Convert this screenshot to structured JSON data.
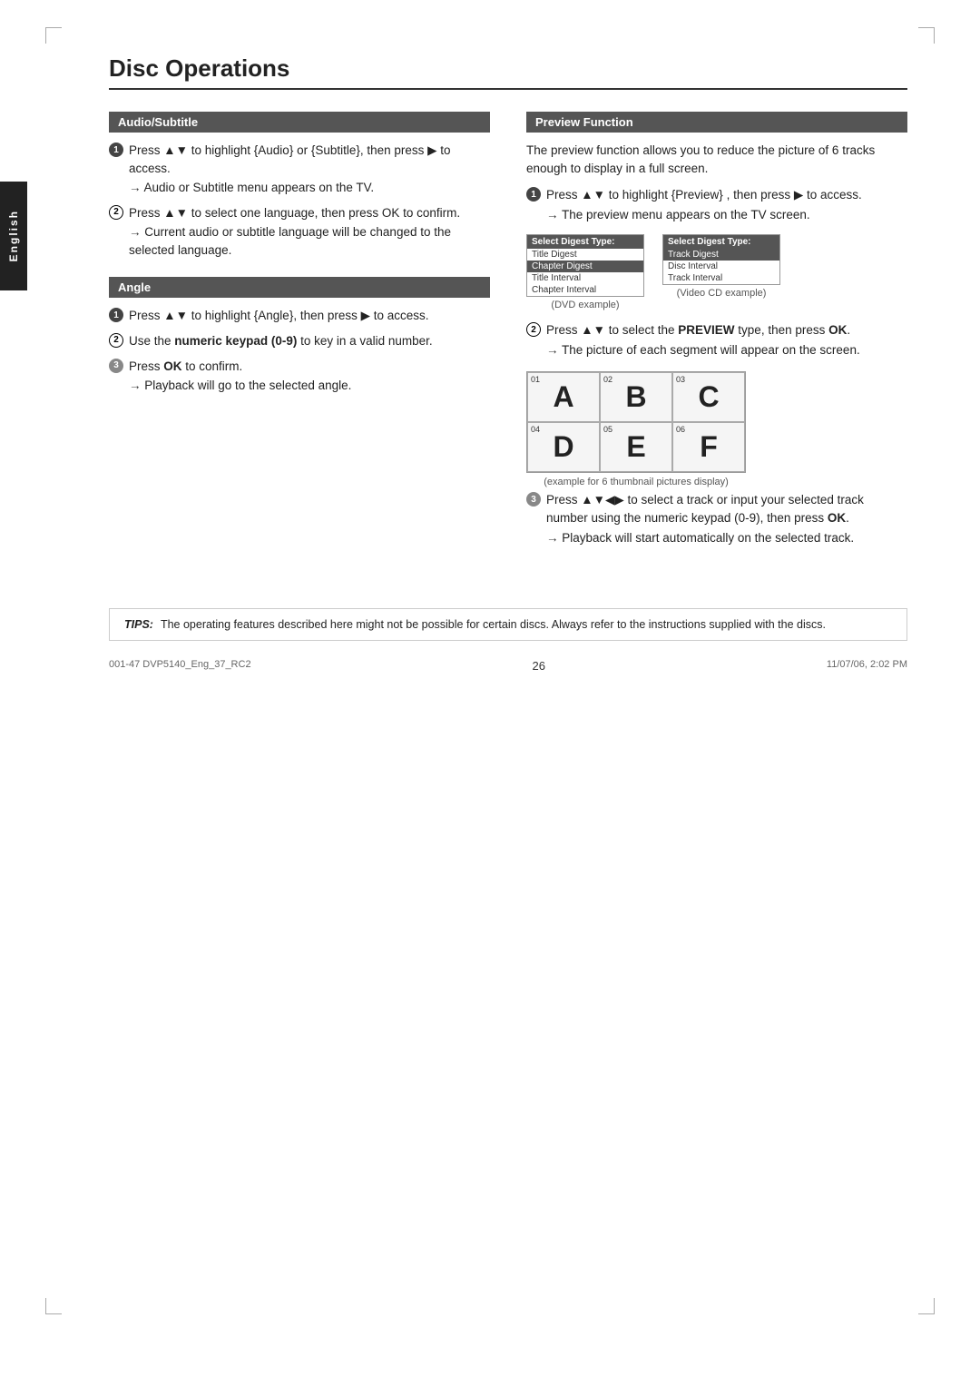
{
  "page": {
    "title": "Disc Operations",
    "number": "26",
    "footer_left": "001-47 DVP5140_Eng_37_RC2",
    "footer_center": "26",
    "footer_right": "11/07/06, 2:02 PM"
  },
  "side_tab": {
    "label": "English"
  },
  "audio_subtitle": {
    "header": "Audio/Subtitle",
    "item1": "Press ▲▼ to highlight {Audio} or {Subtitle}, then press ▶ to access.",
    "item1_sub": "Audio or Subtitle menu appears on the TV.",
    "item2": "Press ▲▼ to select one language, then press OK to confirm.",
    "item2_sub": "Current audio or subtitle language will be changed to the selected language."
  },
  "angle": {
    "header": "Angle",
    "item1": "Press ▲▼ to highlight {Angle}, then press ▶ to access.",
    "item2": "Use the numeric keypad (0-9) to key in a valid number.",
    "item3": "Press OK to confirm.",
    "item3_sub": "Playback will go to the selected angle."
  },
  "preview": {
    "header": "Preview Function",
    "intro": "The preview function allows you to reduce the picture of 6 tracks enough to display in a full screen.",
    "item1": "Press ▲▼ to highlight {Preview} , then press ▶ to access.",
    "item1_sub": "The preview menu appears on the TV screen.",
    "dvd_digest": {
      "label": "(DVD example)",
      "title": "Select Digest Type:",
      "rows": [
        {
          "text": "Title Digest",
          "highlight": false
        },
        {
          "text": "Chapter Digest",
          "highlight": true
        },
        {
          "text": "Title Interval",
          "highlight": false
        },
        {
          "text": "Chapter Interval",
          "highlight": false
        }
      ]
    },
    "vcd_digest": {
      "label": "(Video CD example)",
      "title": "Select Digest Type:",
      "rows": [
        {
          "text": "Track Digest",
          "highlight": true
        },
        {
          "text": "Disc Interval",
          "highlight": false
        },
        {
          "text": "Track Interval",
          "highlight": false
        }
      ]
    },
    "item2": "Press ▲▼ to select the PREVIEW type, then press OK.",
    "item2_sub": "The picture of each segment will appear on the screen.",
    "thumb_cells": [
      {
        "num": "01",
        "letter": "A"
      },
      {
        "num": "02",
        "letter": "B"
      },
      {
        "num": "03",
        "letter": "C"
      },
      {
        "num": "04",
        "letter": "D"
      },
      {
        "num": "05",
        "letter": "E"
      },
      {
        "num": "06",
        "letter": "F"
      }
    ],
    "thumb_caption": "(example for 6 thumbnail pictures display)",
    "item3": "Press ▲▼◀▶ to select a track or input your selected track number using the numeric keypad (0-9), then press OK.",
    "item3_sub": "Playback will start automatically on the selected track."
  },
  "tips": {
    "label": "TIPS:",
    "text": "The operating features described here might not be possible for certain discs.  Always refer to the instructions supplied with the discs."
  }
}
